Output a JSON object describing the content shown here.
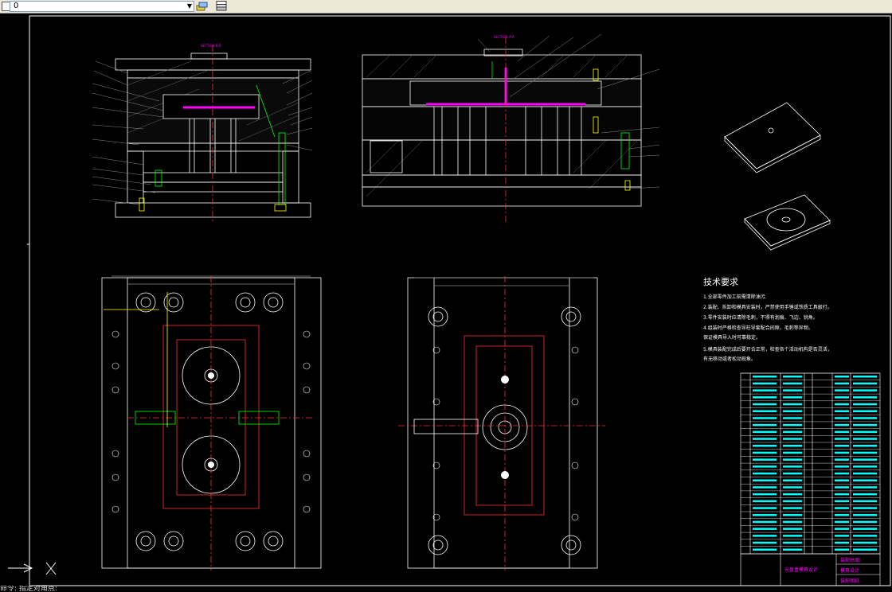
{
  "toolbar": {
    "layer_value": "0",
    "icons": [
      "sun-layer-icon",
      "layers-icon",
      "layer-stack-icon"
    ]
  },
  "drawing": {
    "section_bb": "SECTION B-B",
    "section_aa": "SECTION A-A",
    "tech_title": "技术要求",
    "tech_lines": [
      "1.全部零件加工前需清除油污.",
      "2.装配、拆卸和模具安装时，严禁使用手锤或铁质工具敲打。",
      "3.零件安装时应清除毛刺，不得有划痕、飞边、锐角。",
      "4.组装时严格检查导柱导套配合间隙，毛刺等异物。",
      "保证模具导入时可靠稳定。",
      "5.模具装配完成后要开合正常，检查各个活动机构是否灵活，",
      "有无移动或者松动现象。"
    ],
    "title_block": {
      "name": "光盘盒模具设计",
      "drawing_type": "装配总图",
      "org": "模具设计",
      "doc": "装配图纸"
    }
  },
  "cmdline": "命令: 指定对角点:"
}
